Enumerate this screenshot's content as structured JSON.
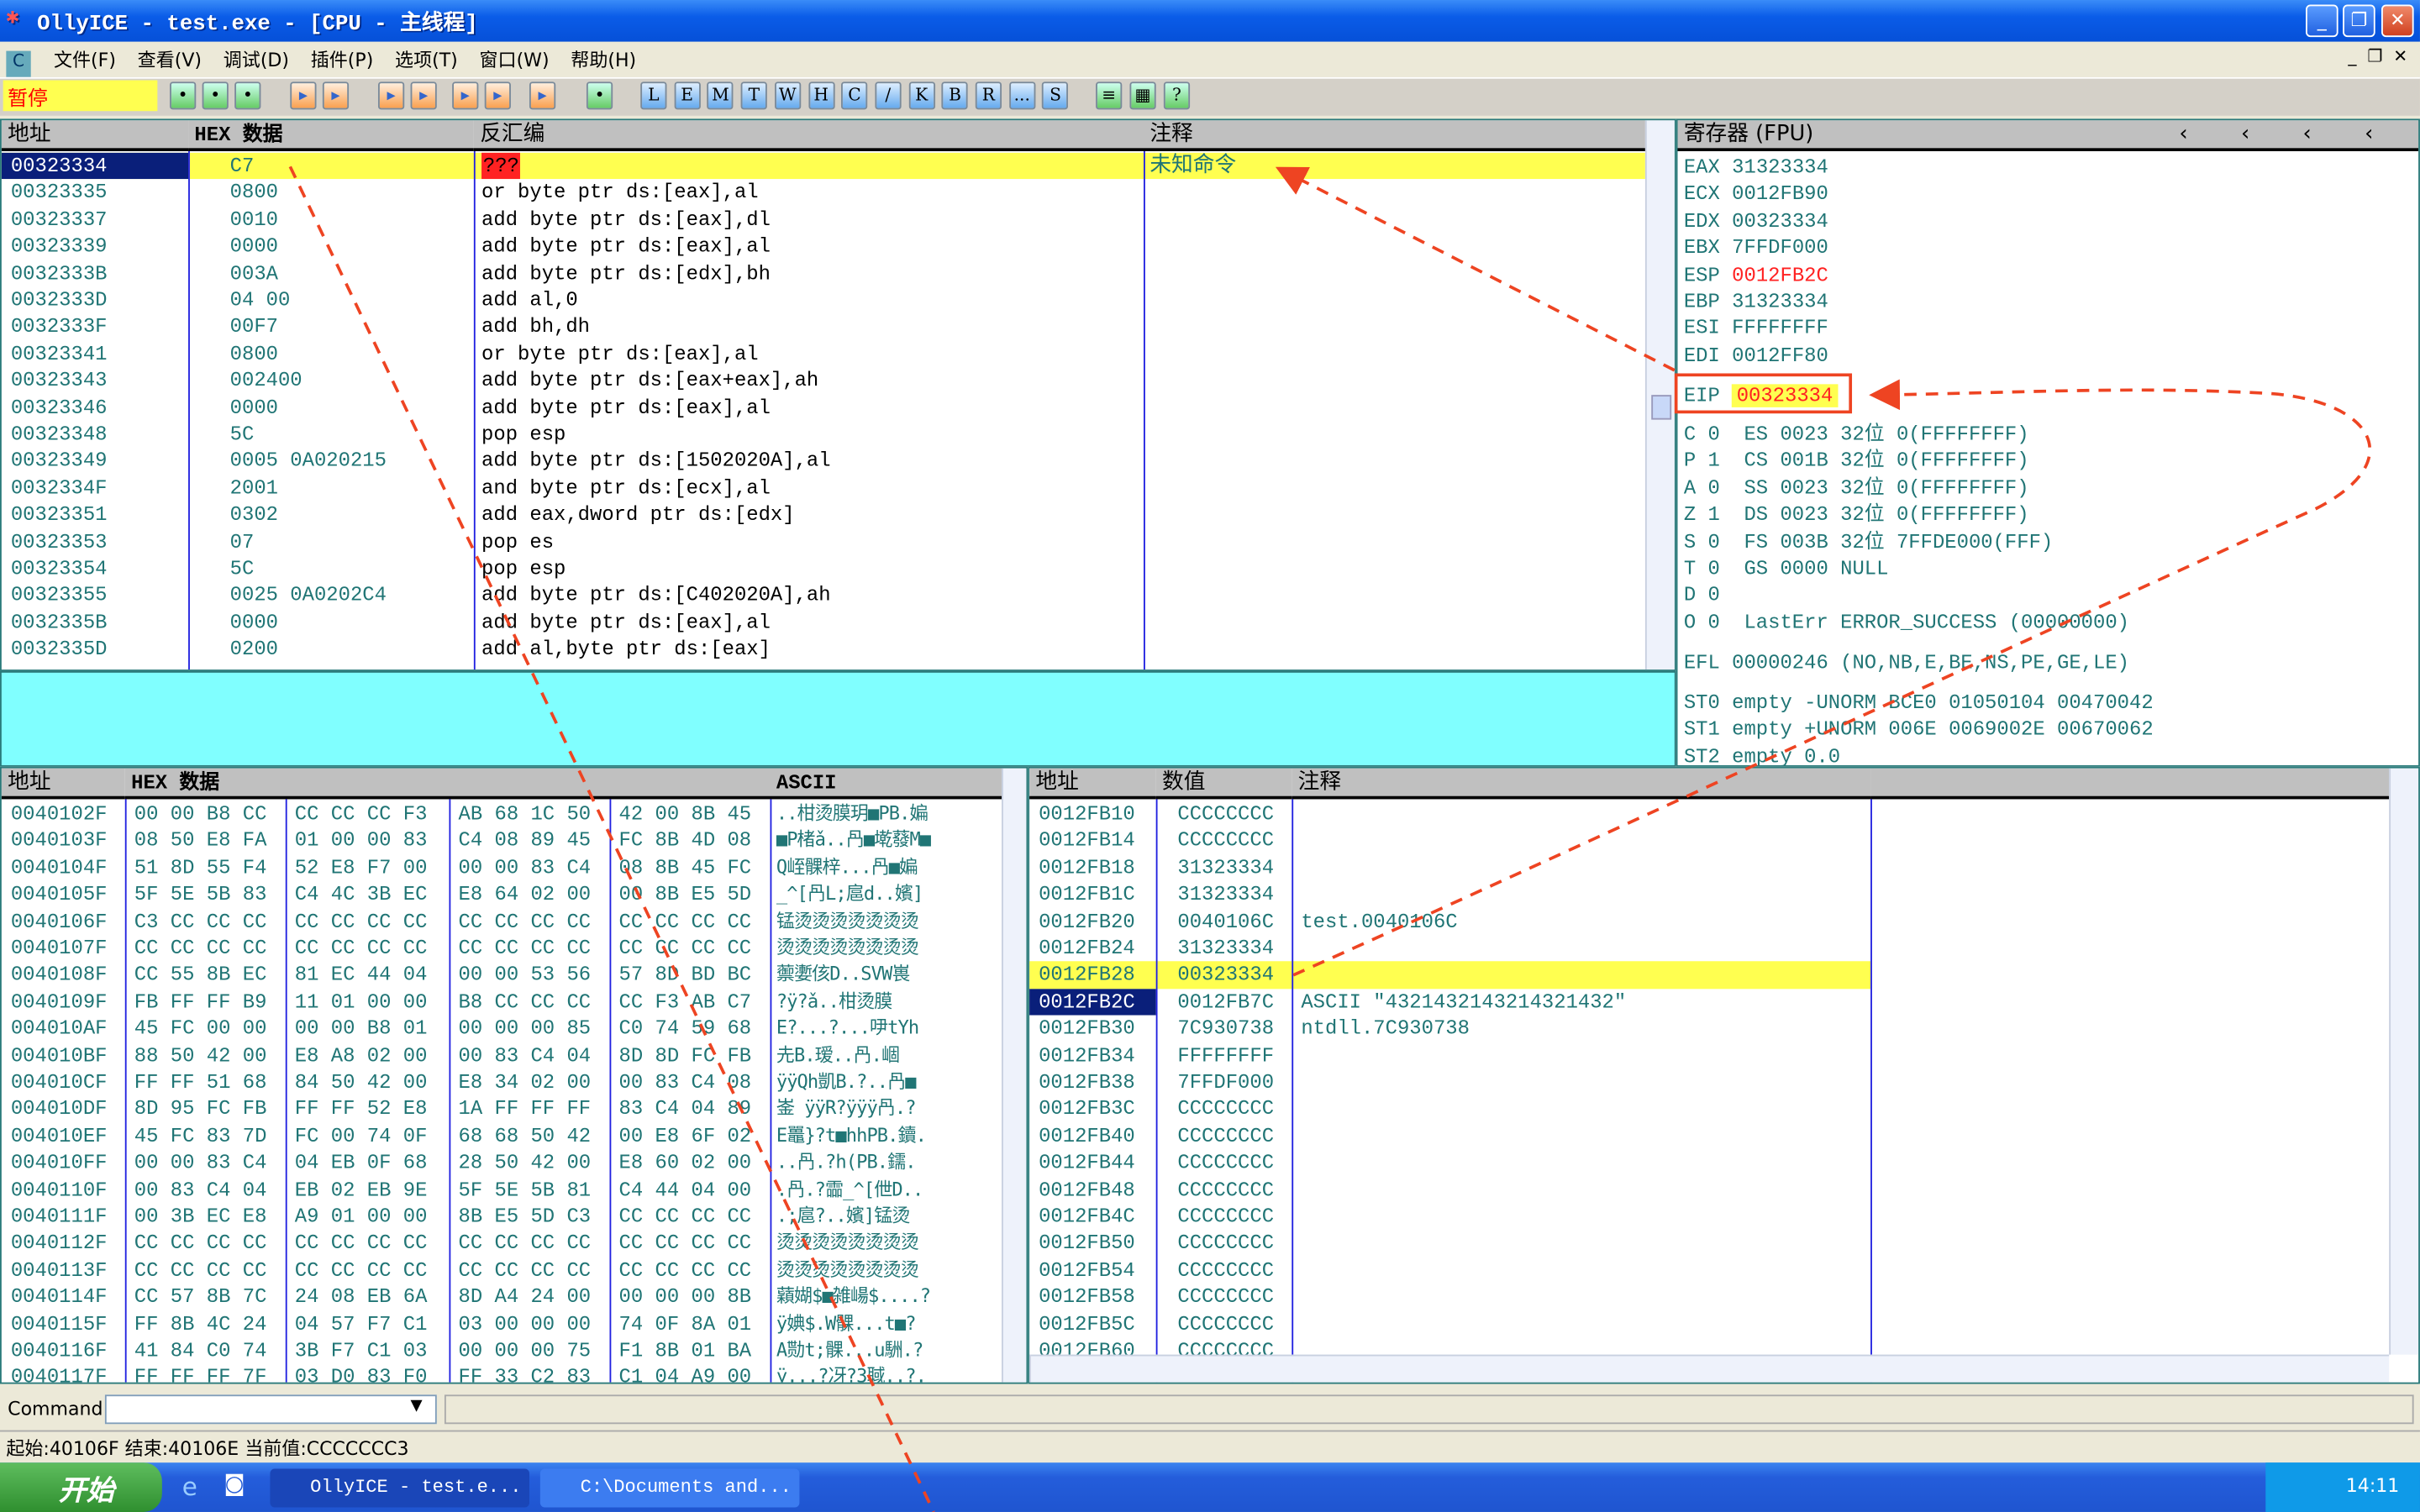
{
  "window": {
    "title": "OllyICE - test.exe - [CPU -  主线程]",
    "status_state": "暂停"
  },
  "menu": [
    "文件(F)",
    "查看(V)",
    "调试(D)",
    "插件(P)",
    "选项(T)",
    "窗口(W)",
    "帮助(H)"
  ],
  "toolbar_letters": [
    "L",
    "E",
    "M",
    "T",
    "W",
    "H",
    "C",
    "/",
    "K",
    "B",
    "R",
    "...",
    "S"
  ],
  "disasm": {
    "headers": [
      "地址",
      "HEX 数据",
      "反汇编",
      "注释"
    ],
    "rows": [
      [
        "00323334",
        "C7",
        "???",
        "未知命令"
      ],
      [
        "00323335",
        "0800",
        "or byte ptr ds:[eax],al",
        ""
      ],
      [
        "00323337",
        "0010",
        "add byte ptr ds:[eax],dl",
        ""
      ],
      [
        "00323339",
        "0000",
        "add byte ptr ds:[eax],al",
        ""
      ],
      [
        "0032333B",
        "003A",
        "add byte ptr ds:[edx],bh",
        ""
      ],
      [
        "0032333D",
        "04 00",
        "add al,0",
        ""
      ],
      [
        "0032333F",
        "00F7",
        "add bh,dh",
        ""
      ],
      [
        "00323341",
        "0800",
        "or byte ptr ds:[eax],al",
        ""
      ],
      [
        "00323343",
        "002400",
        "add byte ptr ds:[eax+eax],ah",
        ""
      ],
      [
        "00323346",
        "0000",
        "add byte ptr ds:[eax],al",
        ""
      ],
      [
        "00323348",
        "5C",
        "pop esp",
        ""
      ],
      [
        "00323349",
        "0005 0A020215",
        "add byte ptr ds:[1502020A],al",
        ""
      ],
      [
        "0032334F",
        "2001",
        "and byte ptr ds:[ecx],al",
        ""
      ],
      [
        "00323351",
        "0302",
        "add eax,dword ptr ds:[edx]",
        ""
      ],
      [
        "00323353",
        "07",
        "pop es",
        ""
      ],
      [
        "00323354",
        "5C",
        "pop esp",
        ""
      ],
      [
        "00323355",
        "0025 0A0202C4",
        "add byte ptr ds:[C402020A],ah",
        ""
      ],
      [
        "0032335B",
        "0000",
        "add byte ptr ds:[eax],al",
        ""
      ],
      [
        "0032335D",
        "0200",
        "add al,byte ptr ds:[eax]",
        ""
      ]
    ]
  },
  "registers": {
    "title": "寄存器 (FPU)",
    "gp": [
      [
        "EAX",
        "31323334"
      ],
      [
        "ECX",
        "0012FB90"
      ],
      [
        "EDX",
        "00323334"
      ],
      [
        "EBX",
        "7FFDF000"
      ],
      [
        "ESP",
        "0012FB2C"
      ],
      [
        "EBP",
        "31323334"
      ],
      [
        "ESI",
        "FFFFFFFF"
      ],
      [
        "EDI",
        "0012FF80"
      ]
    ],
    "eip": [
      "EIP",
      "00323334"
    ],
    "flags": [
      "C 0  ES 0023 32位 0(FFFFFFFF)",
      "P 1  CS 001B 32位 0(FFFFFFFF)",
      "A 0  SS 0023 32位 0(FFFFFFFF)",
      "Z 1  DS 0023 32位 0(FFFFFFFF)",
      "S 0  FS 003B 32位 7FFDE000(FFF)",
      "T 0  GS 0000 NULL",
      "D 0",
      "O 0  LastErr ERROR_SUCCESS (00000000)"
    ],
    "efl": "EFL 00000246 (NO,NB,E,BE,NS,PE,GE,LE)",
    "fpu": [
      "ST0 empty -UNORM BCE0 01050104 00470042",
      "ST1 empty +UNORM 006E 0069002E 00670062",
      "ST2 empty 0.0"
    ]
  },
  "dump": {
    "headers": [
      "地址",
      "HEX 数据",
      "ASCII"
    ],
    "rows": [
      [
        "0040102F",
        "00 00 B8 CC",
        "CC CC CC F3",
        "AB 68 1C 50",
        "42 00 8B 45",
        "..柑烫膜玥■PB.媥"
      ],
      [
        "0040103F",
        "08 50 E8 FA",
        "01 00 00 83",
        "C4 08 89 45",
        "FC 8B 4D 08",
        "■P楮ǎ..冎■墘蕟M■"
      ],
      [
        "0040104F",
        "51 8D 55 F4",
        "52 E8 F7 00",
        "00 00 83 C4",
        "08 8B 45 FC",
        "Q峌髁梓...冎■媥"
      ],
      [
        "0040105F",
        "5F 5E 5B 83",
        "C4 4C 3B EC",
        "E8 64 02 00",
        "00 8B E5 5D",
        "_^[冎L;扈d..嬪]"
      ],
      [
        "0040106F",
        "C3 CC CC CC",
        "CC CC CC CC",
        "CC CC CC CC",
        "CC CC CC CC",
        "锰烫烫烫烫烫烫烫"
      ],
      [
        "0040107F",
        "CC CC CC CC",
        "CC CC CC CC",
        "CC CC CC CC",
        "CC CC CC CC",
        "烫烫烫烫烫烫烫烫"
      ],
      [
        "0040108F",
        "CC 55 8B EC",
        "81 EC 44 04",
        "00 00 53 56",
        "57 8D BD BC",
        "蘌嬱侅D..SVW嵔"
      ],
      [
        "0040109F",
        "FB FF FF B9",
        "11 01 00 00",
        "B8 CC CC CC",
        "CC F3 AB C7",
        "?ÿ?ǎ..柑烫膜"
      ],
      [
        "004010AF",
        "45 FC 00 00",
        "00 00 B8 01",
        "00 00 00 85",
        "C0 74 59 68",
        "E?...?...吚tYh"
      ],
      [
        "004010BF",
        "88 50 42 00",
        "E8 A8 02 00",
        "00 83 C4 04",
        "8D 8D FC FB",
        "圥B.瑷..冎.崓"
      ],
      [
        "004010CF",
        "FF FF 51 68",
        "84 50 42 00",
        "E8 34 02 00",
        "00 83 C4 08",
        "ÿÿQh凱B.?..冎■"
      ],
      [
        "004010DF",
        "8D 95 FC FB",
        "FF FF 52 E8",
        "1A FF FF FF",
        "83 C4 04 89",
        "崟 ÿÿR?ÿÿÿ冎.?"
      ],
      [
        "004010EF",
        "45 FC 83 7D",
        "FC 00 74 0F",
        "68 68 50 42",
        "00 E8 6F 02",
        "E鼉}?t■hhPB.鑟."
      ],
      [
        "004010FF",
        "00 00 83 C4",
        "04 EB 0F 68",
        "28 50 42 00",
        "E8 60 02 00",
        "..冎.?h(PB.鑐."
      ],
      [
        "0040110F",
        "00 83 C4 04",
        "EB 02 EB 9E",
        "5F 5E 5B 81",
        "C4 44 04 00",
        ".冎.?霝_^[伳D.."
      ],
      [
        "0040111F",
        "00 3B EC E8",
        "A9 01 00 00",
        "8B E5 5D C3",
        "CC CC CC CC",
        ".;扈?..嬪]锰烫"
      ],
      [
        "0040112F",
        "CC CC CC CC",
        "CC CC CC CC",
        "CC CC CC CC",
        "CC CC CC CC",
        "烫烫烫烫烫烫烫烫"
      ],
      [
        "0040113F",
        "CC CC CC CC",
        "CC CC CC CC",
        "CC CC CC CC",
        "CC CC CC CC",
        "烫烫烫烫烫烫烫烫"
      ],
      [
        "0040114F",
        "CC 57 8B 7C",
        "24 08 EB 6A",
        "8D A4 24 00",
        "00 00 00 8B",
        "蘔媩$■雑崵$....?"
      ],
      [
        "0040115F",
        "FF 8B 4C 24",
        "04 57 F7 C1",
        "03 00 00 00",
        "74 0F 8A 01",
        "ÿ婰$.W髁...t■?"
      ],
      [
        "0040116F",
        "41 84 C0 74",
        "3B F7 C1 03",
        "00 00 00 75",
        "F1 8B 01 BA",
        "A勚t;髁...u駲.?"
      ],
      [
        "0040117F",
        "FF FF FF 7F",
        "03 D0 83 F0",
        "FF 33 C2 83",
        "C1 04 A9 00",
        "ÿ...?冴?3聝..?."
      ]
    ]
  },
  "stack": {
    "headers": [
      "地址",
      "数值",
      "注释"
    ],
    "rows": [
      [
        "0012FB10",
        "CCCCCCCC",
        ""
      ],
      [
        "0012FB14",
        "CCCCCCCC",
        ""
      ],
      [
        "0012FB18",
        "31323334",
        ""
      ],
      [
        "0012FB1C",
        "31323334",
        ""
      ],
      [
        "0012FB20",
        "0040106C",
        "test.0040106C"
      ],
      [
        "0012FB24",
        "31323334",
        ""
      ],
      [
        "0012FB28",
        "00323334",
        ""
      ],
      [
        "0012FB2C",
        "0012FB7C",
        "ASCII \"4321432143214321432\""
      ],
      [
        "0012FB30",
        "7C930738",
        "ntdll.7C930738"
      ],
      [
        "0012FB34",
        "FFFFFFFF",
        ""
      ],
      [
        "0012FB38",
        "7FFDF000",
        ""
      ],
      [
        "0012FB3C",
        "CCCCCCCC",
        ""
      ],
      [
        "0012FB40",
        "CCCCCCCC",
        ""
      ],
      [
        "0012FB44",
        "CCCCCCCC",
        ""
      ],
      [
        "0012FB48",
        "CCCCCCCC",
        ""
      ],
      [
        "0012FB4C",
        "CCCCCCCC",
        ""
      ],
      [
        "0012FB50",
        "CCCCCCCC",
        ""
      ],
      [
        "0012FB54",
        "CCCCCCCC",
        ""
      ],
      [
        "0012FB58",
        "CCCCCCCC",
        ""
      ],
      [
        "0012FB5C",
        "CCCCCCCC",
        ""
      ],
      [
        "0012FB60",
        "CCCCCCCC",
        ""
      ]
    ]
  },
  "command": {
    "label": "Command",
    "value": ""
  },
  "status": "起始:40106F 结束:40106E 当前值:CCCCCCC3",
  "taskbar": {
    "start": "开始",
    "tasks": [
      "OllyICE - test.e...",
      "C:\\Documents and..."
    ],
    "clock": "14:11"
  },
  "colors": {
    "highlight": "#ffff50",
    "selected": "#0a1f7a",
    "text": "#207575",
    "annotation": "#ee4422",
    "info_pane": "#80ffff"
  }
}
